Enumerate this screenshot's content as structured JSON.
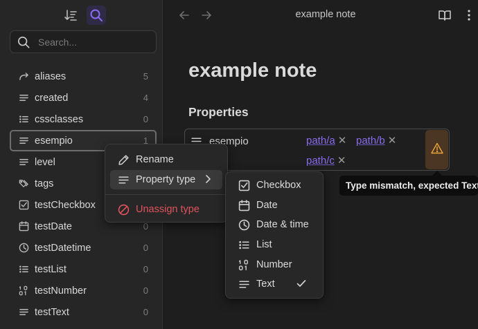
{
  "sidebar": {
    "search_placeholder": "Search...",
    "items": [
      {
        "label": "aliases",
        "count": "5",
        "icon": "forward-arrow-icon"
      },
      {
        "label": "created",
        "count": "4",
        "icon": "text-lines-icon"
      },
      {
        "label": "cssclasses",
        "count": "0",
        "icon": "list-icon"
      },
      {
        "label": "esempio",
        "count": "1",
        "icon": "text-lines-icon"
      },
      {
        "label": "level",
        "count": "",
        "icon": "text-lines-icon"
      },
      {
        "label": "tags",
        "count": "",
        "icon": "tags-icon"
      },
      {
        "label": "testCheckbox",
        "count": "",
        "icon": "checkbox-icon"
      },
      {
        "label": "testDate",
        "count": "0",
        "icon": "calendar-icon"
      },
      {
        "label": "testDatetime",
        "count": "0",
        "icon": "clock-icon"
      },
      {
        "label": "testList",
        "count": "0",
        "icon": "list-icon"
      },
      {
        "label": "testNumber",
        "count": "0",
        "icon": "number-icon"
      },
      {
        "label": "testText",
        "count": "0",
        "icon": "text-lines-icon"
      }
    ]
  },
  "header": {
    "tab_title": "example note"
  },
  "note": {
    "title": "example note",
    "properties_heading": "Properties",
    "property": {
      "key": "esempio",
      "values": [
        "path/a",
        "path/b",
        "path/c"
      ]
    }
  },
  "tooltip": {
    "text": "Type mismatch, expected Text"
  },
  "context_menu": {
    "items": [
      {
        "label": "Rename",
        "icon": "pencil-icon"
      },
      {
        "label": "Property type",
        "icon": "text-lines-icon"
      },
      {
        "label": "Unassign type",
        "icon": "ban-icon"
      }
    ]
  },
  "type_submenu": {
    "items": [
      {
        "label": "Checkbox",
        "icon": "checkbox-icon"
      },
      {
        "label": "Date",
        "icon": "calendar-icon"
      },
      {
        "label": "Date & time",
        "icon": "clock-icon"
      },
      {
        "label": "List",
        "icon": "list-icon"
      },
      {
        "label": "Number",
        "icon": "number-icon"
      },
      {
        "label": "Text",
        "icon": "text-lines-icon",
        "checked": true
      }
    ]
  },
  "colors": {
    "accent": "#8a6cf0",
    "danger": "#e0535e",
    "warning": "#e8a33a",
    "background": "#1e1e1e",
    "sidebar": "#262626"
  }
}
